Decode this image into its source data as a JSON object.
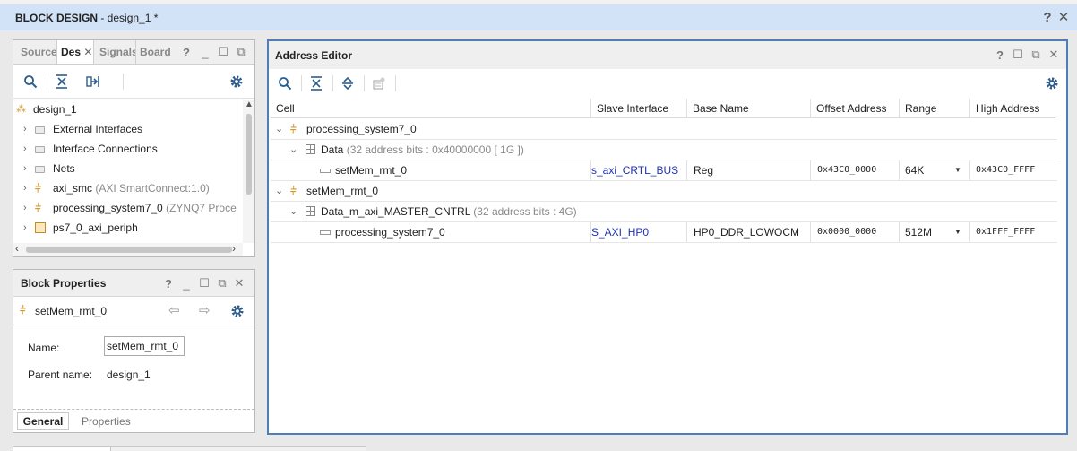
{
  "window": {
    "title_bold": "BLOCK DESIGN",
    "title_rest": " - design_1 *",
    "help_icon": "question-icon",
    "close_icon": "close-icon"
  },
  "sources_panel": {
    "tabs": [
      {
        "label": "Source",
        "active": false
      },
      {
        "label": "Des",
        "active": true
      },
      {
        "label": "Signals",
        "active": false
      },
      {
        "label": "Board",
        "active": false
      }
    ],
    "tree": [
      {
        "label": "design_1",
        "extra": "",
        "icon": "hierarchy-icon"
      },
      {
        "label": "External Interfaces",
        "extra": "",
        "icon": "folder-icon"
      },
      {
        "label": "Interface Connections",
        "extra": "",
        "icon": "folder-icon"
      },
      {
        "label": "Nets",
        "extra": "",
        "icon": "folder-icon"
      },
      {
        "label": "axi_smc",
        "extra": " (AXI SmartConnect:1.0)",
        "icon": "ip-icon"
      },
      {
        "label": "processing_system7_0",
        "extra": " (ZYNQ7 Proce",
        "icon": "ip-icon"
      },
      {
        "label": "ps7_0_axi_periph",
        "extra": "",
        "icon": "hier-block-icon"
      }
    ]
  },
  "block_properties": {
    "title": "Block Properties",
    "selected": "setMem_rmt_0",
    "name_label": "Name:",
    "name_value": "setMem_rmt_0",
    "parent_label": "Parent name:",
    "parent_value": "design_1",
    "tabs": [
      "General",
      "Properties"
    ]
  },
  "address_editor": {
    "title": "Address Editor",
    "columns": [
      "Cell",
      "Slave Interface",
      "Base Name",
      "Offset Address",
      "Range",
      "High Address"
    ],
    "rows": [
      {
        "level": 0,
        "cell": "processing_system7_0",
        "type": "ip"
      },
      {
        "level": 1,
        "cell": "Data",
        "extra": " (32 address bits : 0x40000000 [ 1G ])",
        "type": "space"
      },
      {
        "level": 2,
        "cell": "setMem_rmt_0",
        "type": "seg",
        "slave": "s_axi_CRTL_BUS",
        "base": "Reg",
        "offset": "0x43C0_0000",
        "range": "64K",
        "high": "0x43C0_FFFF"
      },
      {
        "level": 0,
        "cell": "setMem_rmt_0",
        "type": "ip"
      },
      {
        "level": 1,
        "cell": "Data_m_axi_MASTER_CNTRL",
        "extra": " (32 address bits : 4G)",
        "type": "space"
      },
      {
        "level": 2,
        "cell": "processing_system7_0",
        "type": "seg",
        "slave": "S_AXI_HP0",
        "base": "HP0_DDR_LOWOCM",
        "offset": "0x0000_0000",
        "range": "512M",
        "high": "0x1FFF_FFFF"
      }
    ]
  }
}
